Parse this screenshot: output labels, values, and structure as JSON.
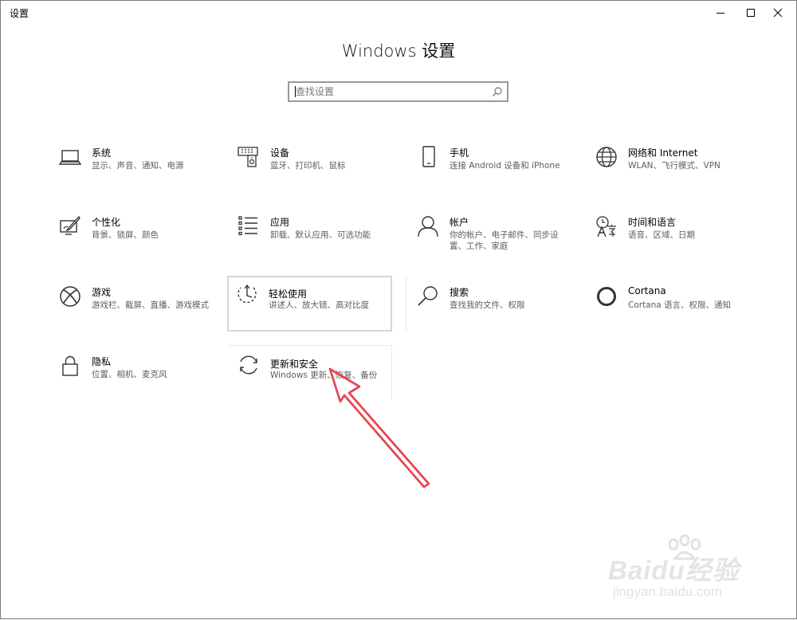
{
  "window": {
    "app_title": "设置"
  },
  "header": {
    "title": "Windows 设置"
  },
  "search": {
    "placeholder": "查找设置"
  },
  "tiles": [
    {
      "name": "系统",
      "desc": "显示、声音、通知、电源",
      "icon": "laptop-icon"
    },
    {
      "name": "设备",
      "desc": "蓝牙、打印机、鼠标",
      "icon": "devices-icon"
    },
    {
      "name": "手机",
      "desc": "连接 Android 设备和 iPhone",
      "icon": "phone-icon"
    },
    {
      "name": "网络和 Internet",
      "desc": "WLAN、飞行模式、VPN",
      "icon": "globe-icon"
    },
    {
      "name": "个性化",
      "desc": "背景、锁屏、颜色",
      "icon": "personalization-icon"
    },
    {
      "name": "应用",
      "desc": "卸载、默认应用、可选功能",
      "icon": "apps-list-icon"
    },
    {
      "name": "帐户",
      "desc": "你的帐户、电子邮件、同步设置、工作、家庭",
      "icon": "person-icon"
    },
    {
      "name": "时间和语言",
      "desc": "语音、区域、日期",
      "icon": "time-language-icon"
    },
    {
      "name": "游戏",
      "desc": "游戏栏、截屏、直播、游戏模式",
      "icon": "xbox-icon"
    },
    {
      "name": "轻松使用",
      "desc": "讲述人、放大镜、高对比度",
      "icon": "ease-of-access-icon"
    },
    {
      "name": "搜索",
      "desc": "查找我的文件、权限",
      "icon": "search-icon"
    },
    {
      "name": "Cortana",
      "desc": "Cortana 语言、权限、通知",
      "icon": "cortana-icon"
    },
    {
      "name": "隐私",
      "desc": "位置、相机、麦克风",
      "icon": "lock-icon"
    },
    {
      "name": "更新和安全",
      "desc": "Windows 更新、恢复、备份",
      "icon": "sync-icon"
    }
  ],
  "watermark": {
    "brand": "Baidu经验",
    "url": "jingyan.baidu.com"
  },
  "colors": {
    "annotation_arrow": "#e0202e",
    "tile_hover_border": "#d6d6d6"
  }
}
